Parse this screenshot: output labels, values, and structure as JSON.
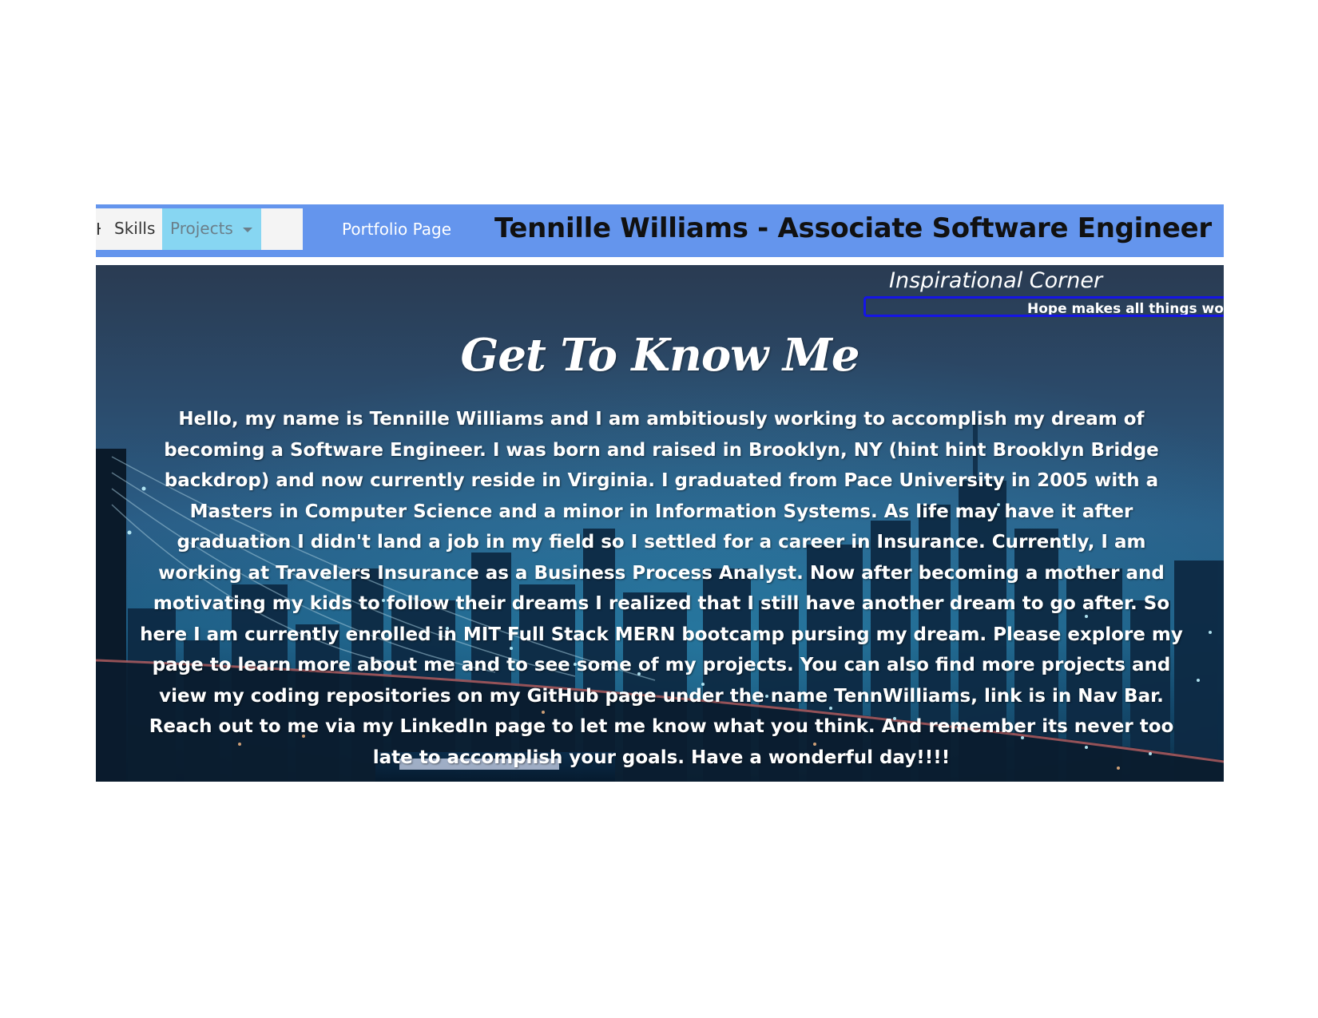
{
  "nav": {
    "cut_item": "Home",
    "skills": "Skills",
    "projects": "Projects",
    "portfolio": "Portfolio Page",
    "title": "Tennille Williams - Associate Software Engineer"
  },
  "inspiration": {
    "title": "Inspirational Corner",
    "quote": "Hope makes all things wor"
  },
  "main": {
    "heading": "Get To Know Me",
    "bio": "Hello, my name is Tennille Williams and I am ambitiously working to accomplish my dream of becoming a Software Engineer. I was born and raised in Brooklyn, NY (hint hint Brooklyn Bridge backdrop) and now currently reside in Virginia. I graduated from Pace University in 2005 with a Masters in Computer Science and a minor in Information Systems. As life may have it after graduation I didn't land a job in my field so I settled for a career in Insurance. Currently, I am working at Travelers Insurance as a Business Process Analyst. Now after becoming a mother and motivating my kids to follow their dreams I realized that I still have another dream to go after. So here I am currently enrolled in MIT Full Stack MERN bootcamp pursing my dream. Please explore my page to learn more about me and to see some of my projects. You can also find more projects and view my coding repositories on my GitHub page under the name TennWilliams, link is in Nav Bar. Reach out to me via my LinkedIn page to let me know what you think. And remember its never too late to accomplish your goals. Have a wonderful day!!!!"
  },
  "colors": {
    "navbar": "#6495ed",
    "projects_active": "#87d6f2",
    "marquee_border": "#1515e6"
  }
}
